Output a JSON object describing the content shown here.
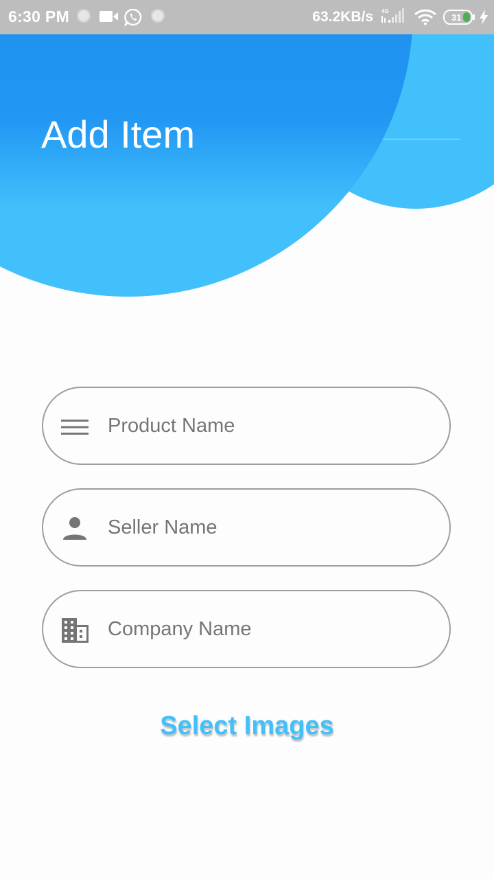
{
  "status_bar": {
    "time": "6:30 PM",
    "network_speed": "63.2KB/s",
    "network_type": "4G",
    "battery_level": "31",
    "icons": [
      "circle-notification-icon",
      "video-camera-icon",
      "whatsapp-icon",
      "circle-notification-icon",
      "signal-icon",
      "wifi-icon",
      "battery-icon",
      "charging-bolt-icon"
    ]
  },
  "header": {
    "title": "Add Item",
    "colors": {
      "primary": "#2196f3",
      "secondary": "#42c0fb"
    }
  },
  "form": {
    "product_name": {
      "placeholder": "Product Name",
      "value": "",
      "icon": "menu-lines-icon"
    },
    "seller_name": {
      "placeholder": "Seller Name",
      "value": "",
      "icon": "person-icon"
    },
    "company_name": {
      "placeholder": "Company Name",
      "value": "",
      "icon": "building-icon"
    },
    "select_images_label": "Select Images"
  }
}
